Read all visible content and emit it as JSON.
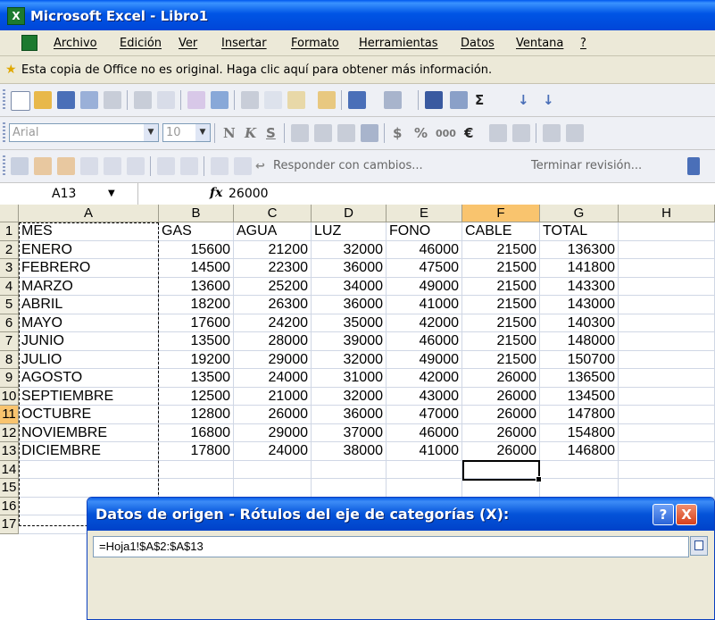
{
  "window": {
    "title": "Microsoft Excel - Libro1"
  },
  "menu": [
    "Archivo",
    "Edición",
    "Ver",
    "Insertar",
    "Formato",
    "Herramientas",
    "Datos",
    "Ventana",
    "?"
  ],
  "banner": {
    "text": "Esta copia de Office no es original. Haga clic aquí para obtener más información."
  },
  "format_toolbar": {
    "font": "Arial",
    "size": "10",
    "bold": "N",
    "italic": "K",
    "underline": "S",
    "currency": "$",
    "percent": "%",
    "thousands": "000",
    "euro": "€"
  },
  "review_toolbar": {
    "reply": "Responder con cambios...",
    "end_review": "Terminar revisión..."
  },
  "formula_bar": {
    "name_box": "A13",
    "fx": "fx",
    "value": "26000"
  },
  "sheet": {
    "columns": [
      "A",
      "B",
      "C",
      "D",
      "E",
      "F",
      "G",
      "H"
    ],
    "rows": [
      "1",
      "2",
      "3",
      "4",
      "5",
      "6",
      "7",
      "8",
      "9",
      "10",
      "11",
      "12",
      "13",
      "14",
      "15",
      "16",
      "17"
    ],
    "selected_column": "F",
    "selected_row": "11",
    "header_row": [
      "MES",
      "GAS",
      "AGUA",
      "LUZ",
      "FONO",
      "CABLE",
      "TOTAL"
    ],
    "data": [
      [
        "ENERO",
        "15600",
        "21200",
        "32000",
        "46000",
        "21500",
        "136300"
      ],
      [
        "FEBRERO",
        "14500",
        "22300",
        "36000",
        "47500",
        "21500",
        "141800"
      ],
      [
        "MARZO",
        "13600",
        "25200",
        "34000",
        "49000",
        "21500",
        "143300"
      ],
      [
        "ABRIL",
        "18200",
        "26300",
        "36000",
        "41000",
        "21500",
        "143000"
      ],
      [
        "MAYO",
        "17600",
        "24200",
        "35000",
        "42000",
        "21500",
        "140300"
      ],
      [
        "JUNIO",
        "13500",
        "28000",
        "39000",
        "46000",
        "21500",
        "148000"
      ],
      [
        "JULIO",
        "19200",
        "29000",
        "32000",
        "49000",
        "21500",
        "150700"
      ],
      [
        "AGOSTO",
        "13500",
        "24000",
        "31000",
        "42000",
        "26000",
        "136500"
      ],
      [
        "SEPTIEMBRE",
        "12500",
        "21000",
        "32000",
        "43000",
        "26000",
        "134500"
      ],
      [
        "OCTUBRE",
        "12800",
        "26000",
        "36000",
        "47000",
        "26000",
        "147800"
      ],
      [
        "NOVIEMBRE",
        "16800",
        "29000",
        "37000",
        "46000",
        "26000",
        "154800"
      ],
      [
        "DICIEMBRE",
        "17800",
        "24000",
        "38000",
        "41000",
        "26000",
        "146800"
      ]
    ]
  },
  "dialog": {
    "title": "Datos de origen - Rótulos del eje de categorías (X):",
    "range_value": "=Hoja1!$A$2:$A$13",
    "help": "?",
    "close": "X"
  },
  "colors": {
    "title_bar": "#0055e5",
    "header_bg": "#ece9d8",
    "selected_header": "#f9c46e"
  }
}
